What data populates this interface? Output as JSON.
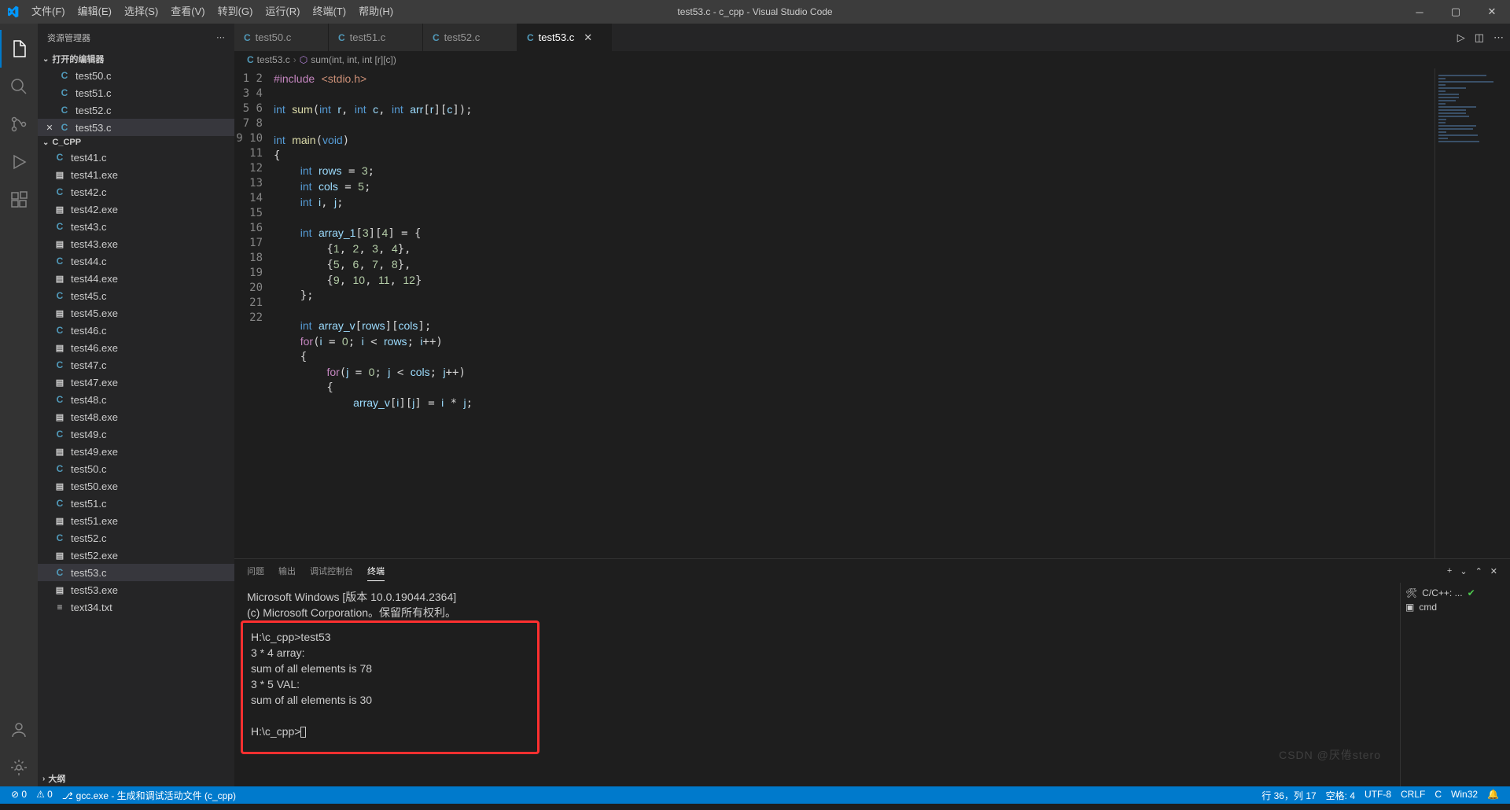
{
  "window": {
    "title": "test53.c - c_cpp - Visual Studio Code"
  },
  "menu": [
    "文件(F)",
    "编辑(E)",
    "选择(S)",
    "查看(V)",
    "转到(G)",
    "运行(R)",
    "终端(T)",
    "帮助(H)"
  ],
  "sidebar": {
    "title": "资源管理器",
    "openEditors": {
      "label": "打开的编辑器",
      "files": [
        "test50.c",
        "test51.c",
        "test52.c",
        "test53.c"
      ],
      "activeIndex": 3
    },
    "folder": {
      "name": "C_CPP",
      "items": [
        {
          "name": "test41.c",
          "type": "c"
        },
        {
          "name": "test41.exe",
          "type": "exe"
        },
        {
          "name": "test42.c",
          "type": "c"
        },
        {
          "name": "test42.exe",
          "type": "exe"
        },
        {
          "name": "test43.c",
          "type": "c"
        },
        {
          "name": "test43.exe",
          "type": "exe"
        },
        {
          "name": "test44.c",
          "type": "c"
        },
        {
          "name": "test44.exe",
          "type": "exe"
        },
        {
          "name": "test45.c",
          "type": "c"
        },
        {
          "name": "test45.exe",
          "type": "exe"
        },
        {
          "name": "test46.c",
          "type": "c"
        },
        {
          "name": "test46.exe",
          "type": "exe"
        },
        {
          "name": "test47.c",
          "type": "c"
        },
        {
          "name": "test47.exe",
          "type": "exe"
        },
        {
          "name": "test48.c",
          "type": "c"
        },
        {
          "name": "test48.exe",
          "type": "exe"
        },
        {
          "name": "test49.c",
          "type": "c"
        },
        {
          "name": "test49.exe",
          "type": "exe"
        },
        {
          "name": "test50.c",
          "type": "c"
        },
        {
          "name": "test50.exe",
          "type": "exe"
        },
        {
          "name": "test51.c",
          "type": "c"
        },
        {
          "name": "test51.exe",
          "type": "exe"
        },
        {
          "name": "test52.c",
          "type": "c"
        },
        {
          "name": "test52.exe",
          "type": "exe"
        },
        {
          "name": "test53.c",
          "type": "c",
          "active": true
        },
        {
          "name": "test53.exe",
          "type": "exe"
        },
        {
          "name": "text34.txt",
          "type": "txt"
        }
      ]
    },
    "outline": "大纲"
  },
  "tabs": [
    {
      "label": "test50.c"
    },
    {
      "label": "test51.c"
    },
    {
      "label": "test52.c"
    },
    {
      "label": "test53.c",
      "active": true
    }
  ],
  "breadcrumb": {
    "file": "test53.c",
    "symbol": "sum(int, int, int [r][c])"
  },
  "code": {
    "lineStart": 1,
    "lines": [
      "<span class='pp'>#include</span> <span class='str'>&lt;stdio.h&gt;</span>",
      "",
      "<span class='kw'>int</span> <span class='fn'>sum</span>(<span class='kw'>int</span> <span class='var'>r</span>, <span class='kw'>int</span> <span class='var'>c</span>, <span class='kw'>int</span> <span class='var'>arr</span>[<span class='var'>r</span>][<span class='var'>c</span>]);",
      "",
      "<span class='kw'>int</span> <span class='fn'>main</span>(<span class='kw'>void</span>)",
      "{",
      "    <span class='kw'>int</span> <span class='var'>rows</span> = <span class='num'>3</span>;",
      "    <span class='kw'>int</span> <span class='var'>cols</span> = <span class='num'>5</span>;",
      "    <span class='kw'>int</span> <span class='var'>i</span>, <span class='var'>j</span>;",
      "",
      "    <span class='kw'>int</span> <span class='var'>array_1</span>[<span class='num'>3</span>][<span class='num'>4</span>] = {",
      "        {<span class='num'>1</span>, <span class='num'>2</span>, <span class='num'>3</span>, <span class='num'>4</span>},",
      "        {<span class='num'>5</span>, <span class='num'>6</span>, <span class='num'>7</span>, <span class='num'>8</span>},",
      "        {<span class='num'>9</span>, <span class='num'>10</span>, <span class='num'>11</span>, <span class='num'>12</span>}",
      "    };",
      "",
      "    <span class='kw'>int</span> <span class='var'>array_v</span>[<span class='var'>rows</span>][<span class='var'>cols</span>];",
      "    <span class='pp'>for</span>(<span class='var'>i</span> = <span class='num'>0</span>; <span class='var'>i</span> &lt; <span class='var'>rows</span>; <span class='var'>i</span>++)",
      "    {",
      "        <span class='pp'>for</span>(<span class='var'>j</span> = <span class='num'>0</span>; <span class='var'>j</span> &lt; <span class='var'>cols</span>; <span class='var'>j</span>++)",
      "        {",
      "            <span class='var'>array_v</span>[<span class='var'>i</span>][<span class='var'>j</span>] = <span class='var'>i</span> * <span class='var'>j</span>;"
    ]
  },
  "panel": {
    "tabs": [
      "问题",
      "输出",
      "调试控制台",
      "终端"
    ],
    "activeTab": 3,
    "preLines": [
      "Microsoft Windows [版本 10.0.19044.2364]",
      "(c) Microsoft Corporation。保留所有权利。"
    ],
    "termLines": [
      "H:\\c_cpp>test53",
      "3 * 4 array:",
      "sum of all elements is 78",
      "3 * 5 VAL:",
      "sum of all elements is 30",
      "",
      "H:\\c_cpp>"
    ],
    "tasks": [
      {
        "label": "C/C++: ...",
        "check": true
      },
      {
        "label": "cmd",
        "icon": "term"
      }
    ]
  },
  "status": {
    "left": [
      "⊘ 0",
      "⚠ 0",
      "gcc.exe - 生成和调试活动文件 (c_cpp)"
    ],
    "right": [
      "行 36，列 17",
      "空格: 4",
      "UTF-8",
      "CRLF",
      "C",
      "Win32",
      "🔔"
    ]
  },
  "watermark": "CSDN @厌倦stero"
}
